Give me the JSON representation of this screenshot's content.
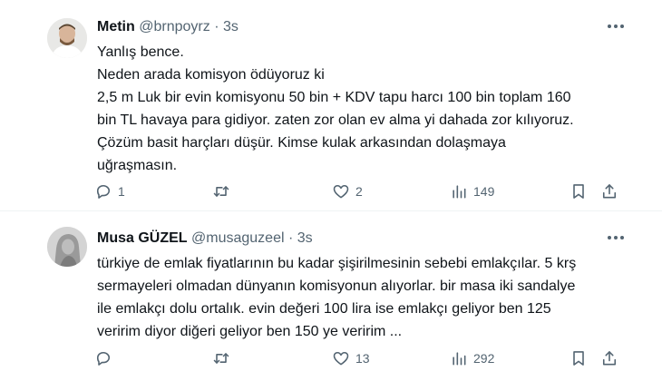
{
  "tweets": [
    {
      "name": "Metin",
      "handle": "@brnpoyrz",
      "separator": "·",
      "time": "3s",
      "lines": [
        "Yanlış bence.",
        "Neden arada komisyon ödüyoruz ki",
        "2,5 m Luk bir evin komisyonu 50 bin + KDV tapu harcı 100 bin toplam 160",
        "bin TL havaya para gidiyor. zaten zor olan ev alma yi dahada zor kılıyoruz.",
        "Çözüm basit harçları düşür. Kimse kulak arkasından dolaşmaya",
        "uğraşmasın."
      ],
      "replies": "1",
      "retweets": "",
      "likes": "2",
      "views": "149"
    },
    {
      "name": "Musa GÜZEL",
      "handle": "@musaguzeel",
      "separator": "·",
      "time": "3s",
      "lines": [
        "türkiye de emlak fiyatlarının bu kadar şişirilmesinin sebebi emlakçılar. 5 krş",
        "sermayeleri olmadan dünyanın komisyonun alıyorlar. bir masa iki sandalye",
        "ile emlakçı dolu ortalık.  evin değeri 100 lira ise emlakçı geliyor ben 125",
        "veririm diyor diğeri geliyor ben 150 ye veririm ..."
      ],
      "replies": "",
      "retweets": "",
      "likes": "13",
      "views": "292"
    }
  ],
  "icons": {
    "reply": "reply-icon",
    "retweet": "retweet-icon",
    "like": "heart-icon",
    "views": "views-icon",
    "bookmark": "bookmark-icon",
    "share": "share-icon",
    "more": "more-icon"
  },
  "colors": {
    "text": "#0f1419",
    "secondary": "#536471",
    "divider": "#eff3f4"
  }
}
